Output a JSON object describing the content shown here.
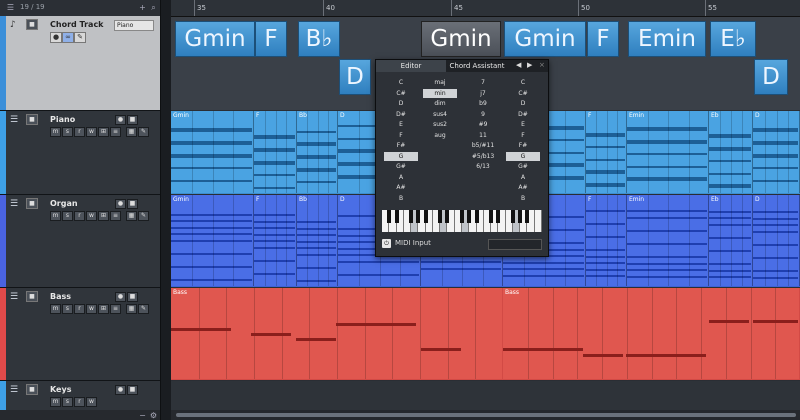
{
  "header": {
    "counter": "19 / 19"
  },
  "ruler": {
    "bars": [
      "35",
      "40",
      "45",
      "50",
      "55"
    ]
  },
  "tracks": [
    {
      "id": "chord",
      "name": "Chord Track",
      "preset": "Piano",
      "color": "#3b8fd9"
    },
    {
      "id": "piano",
      "name": "Piano",
      "color": "#3ea0e6"
    },
    {
      "id": "organ",
      "name": "Organ",
      "color": "#4a63e0"
    },
    {
      "id": "bass",
      "name": "Bass",
      "color": "#e04a4a"
    },
    {
      "id": "keys",
      "name": "Keys",
      "color": "#3ea0e6"
    }
  ],
  "chord_events": [
    {
      "label": "Gmin",
      "row": "top",
      "selected": false
    },
    {
      "label": "F",
      "row": "top",
      "selected": false
    },
    {
      "label": "B♭",
      "row": "top",
      "selected": false
    },
    {
      "label": "D",
      "row": "bottom",
      "selected": false
    },
    {
      "label": "Gmin",
      "row": "top",
      "selected": true
    },
    {
      "label": "Gmin",
      "row": "top",
      "selected": false
    },
    {
      "label": "F",
      "row": "top",
      "selected": false
    },
    {
      "label": "Emin",
      "row": "top",
      "selected": false
    },
    {
      "label": "E♭",
      "row": "top",
      "selected": false
    },
    {
      "label": "D",
      "row": "bottom",
      "selected": false
    }
  ],
  "part_labels": {
    "piano": [
      "Gmin",
      "F",
      "Bb",
      "D",
      "F",
      "Emin",
      "Eb",
      "D"
    ],
    "organ": [
      "Gmin",
      "F",
      "Bb",
      "D",
      "F",
      "Emin",
      "Eb",
      "D"
    ],
    "bass": [
      "Bass",
      "Bass"
    ]
  },
  "colors": {
    "piano_part": "#4aa3e2",
    "organ_part": "#4a6ee6",
    "bass_part": "#e0574f",
    "chord_event": "#3d8fd0"
  },
  "chord_editor": {
    "tabs": [
      "Editor",
      "Chord Assistant"
    ],
    "root_notes": [
      "C",
      "C#",
      "D",
      "D#",
      "E",
      "F",
      "F#",
      "G",
      "G#",
      "A",
      "A#",
      "B"
    ],
    "root_selected": "G",
    "types": [
      "maj",
      "min",
      "dim",
      "sus4",
      "sus2",
      "aug"
    ],
    "type_selected": "min",
    "tensions": [
      "7",
      "j7",
      "b9",
      "9",
      "#9",
      "11",
      "b5/#11",
      "#5/b13",
      "6/13"
    ],
    "bass_notes": [
      "C",
      "C#",
      "D",
      "D#",
      "E",
      "F",
      "F#",
      "G",
      "G#",
      "A",
      "A#",
      "B"
    ],
    "bass_selected": "G",
    "midi_input_label": "MIDI Input"
  }
}
